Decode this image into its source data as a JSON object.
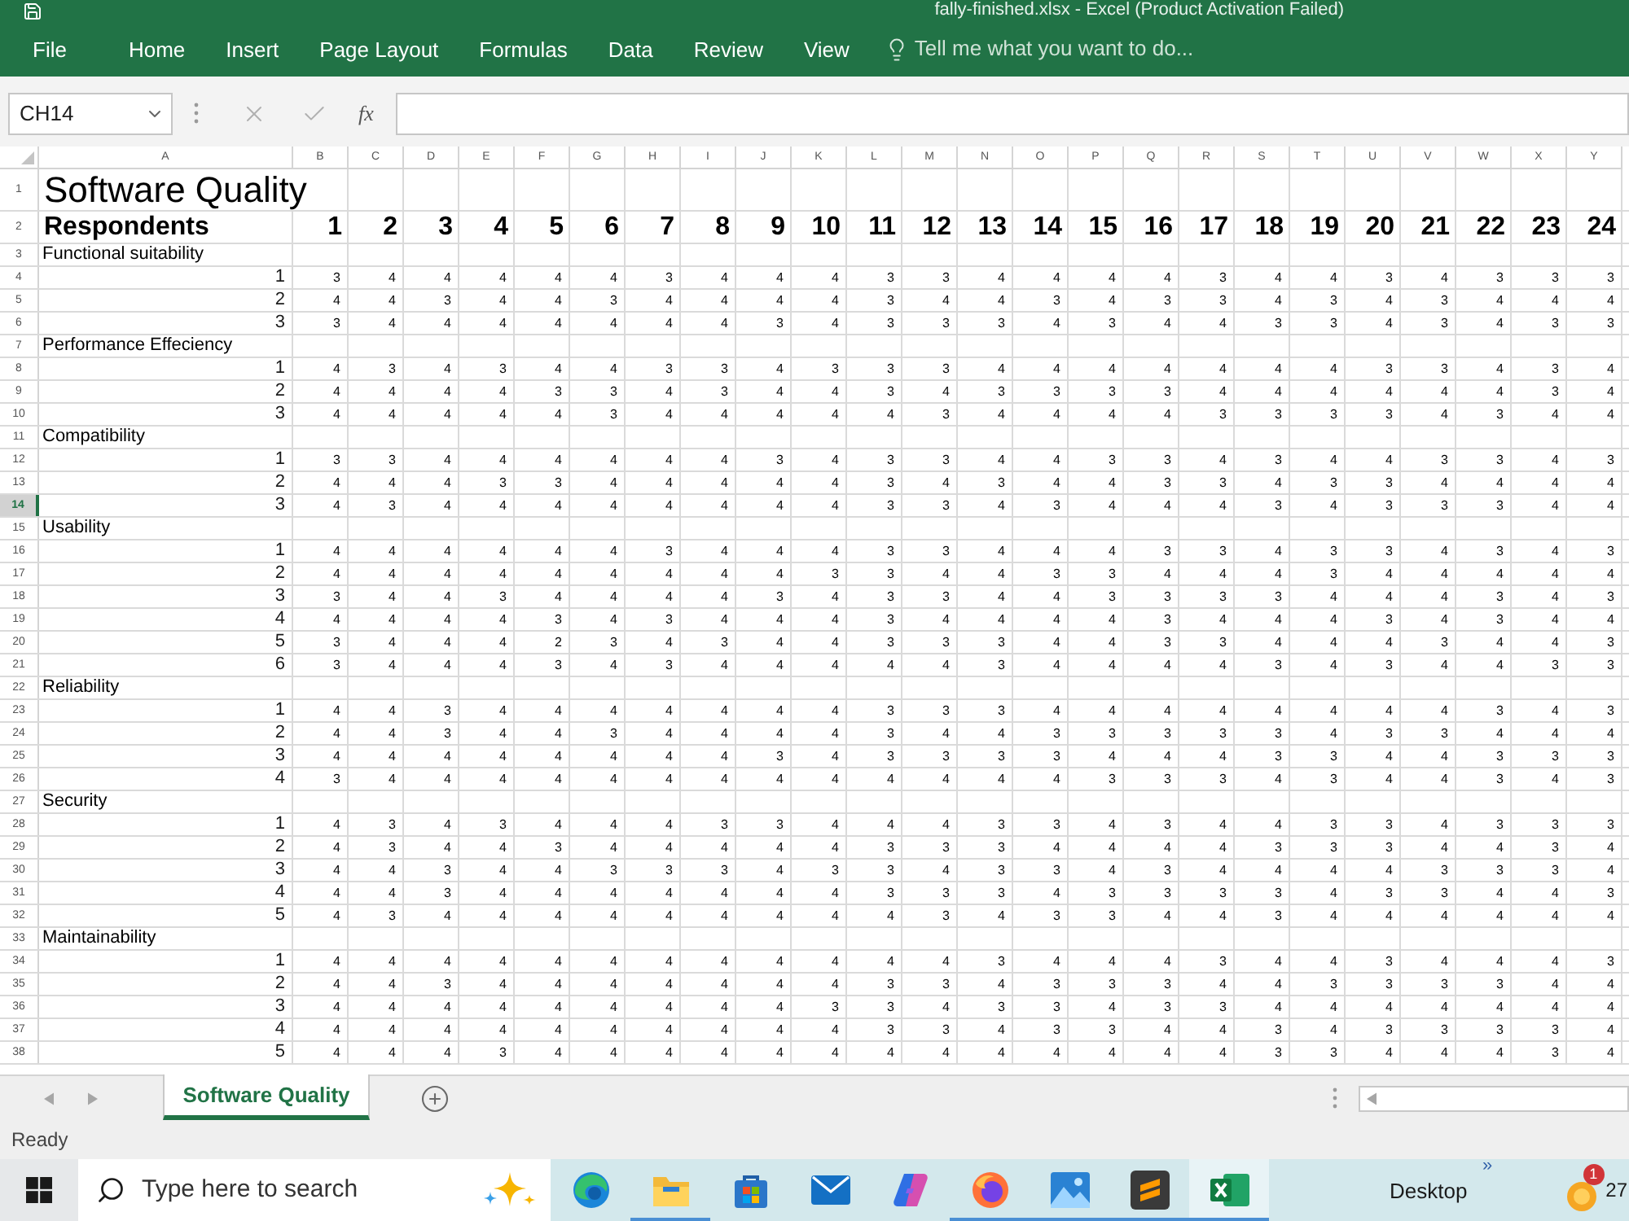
{
  "window": {
    "title": "fally-finished.xlsx - Excel (Product Activation Failed)"
  },
  "ribbon": {
    "file": "File",
    "tabs": [
      "Home",
      "Insert",
      "Page Layout",
      "Formulas",
      "Data",
      "Review",
      "View"
    ],
    "tell_me": {
      "placeholder": "Tell me what you want to do..."
    }
  },
  "formula_bar": {
    "name_box": "CH14",
    "function_button": "fx"
  },
  "sheet": {
    "columns": [
      "A",
      "B",
      "C",
      "D",
      "E",
      "F",
      "G",
      "H",
      "I",
      "J",
      "K",
      "L",
      "M",
      "N",
      "O",
      "P",
      "Q",
      "R",
      "S",
      "T",
      "U",
      "V",
      "W",
      "X",
      "Y"
    ],
    "rows": [
      {
        "number": "1",
        "kind": "title",
        "text": "Software Quality",
        "selected": false
      },
      {
        "number": "2",
        "kind": "header",
        "text": "Respondents",
        "values": [
          "1",
          "2",
          "3",
          "4",
          "5",
          "6",
          "7",
          "8",
          "9",
          "10",
          "11",
          "12",
          "13",
          "14",
          "15",
          "16",
          "17",
          "18",
          "19",
          "20",
          "21",
          "22",
          "23",
          "24"
        ],
        "selected": false
      },
      {
        "number": "3",
        "kind": "section",
        "text": "Functional suitability",
        "selected": false
      },
      {
        "number": "4",
        "kind": "data",
        "text": "1",
        "values": [
          "3",
          "4",
          "4",
          "4",
          "4",
          "4",
          "3",
          "4",
          "4",
          "4",
          "3",
          "3",
          "4",
          "4",
          "4",
          "4",
          "3",
          "4",
          "4",
          "3",
          "4",
          "3",
          "3",
          "3"
        ],
        "selected": false
      },
      {
        "number": "5",
        "kind": "data",
        "text": "2",
        "values": [
          "4",
          "4",
          "3",
          "4",
          "4",
          "3",
          "4",
          "4",
          "4",
          "4",
          "3",
          "4",
          "4",
          "3",
          "4",
          "3",
          "3",
          "4",
          "3",
          "4",
          "3",
          "4",
          "4",
          "4"
        ],
        "selected": false
      },
      {
        "number": "6",
        "kind": "data",
        "text": "3",
        "values": [
          "3",
          "4",
          "4",
          "4",
          "4",
          "4",
          "4",
          "4",
          "3",
          "4",
          "3",
          "3",
          "3",
          "4",
          "3",
          "4",
          "4",
          "3",
          "3",
          "4",
          "3",
          "4",
          "3",
          "3"
        ],
        "selected": false
      },
      {
        "number": "7",
        "kind": "section",
        "text": "Performance Effeciency",
        "selected": false
      },
      {
        "number": "8",
        "kind": "data",
        "text": "1",
        "values": [
          "4",
          "3",
          "4",
          "3",
          "4",
          "4",
          "3",
          "3",
          "4",
          "3",
          "3",
          "3",
          "4",
          "4",
          "4",
          "4",
          "4",
          "4",
          "4",
          "3",
          "3",
          "4",
          "3",
          "4"
        ],
        "selected": false
      },
      {
        "number": "9",
        "kind": "data",
        "text": "2",
        "values": [
          "4",
          "4",
          "4",
          "4",
          "3",
          "3",
          "4",
          "3",
          "4",
          "4",
          "3",
          "4",
          "3",
          "3",
          "3",
          "3",
          "4",
          "4",
          "4",
          "4",
          "4",
          "4",
          "3",
          "4"
        ],
        "selected": false
      },
      {
        "number": "10",
        "kind": "data",
        "text": "3",
        "values": [
          "4",
          "4",
          "4",
          "4",
          "4",
          "3",
          "4",
          "4",
          "4",
          "4",
          "4",
          "3",
          "4",
          "4",
          "4",
          "4",
          "3",
          "3",
          "3",
          "3",
          "4",
          "3",
          "4",
          "4"
        ],
        "selected": false
      },
      {
        "number": "11",
        "kind": "section",
        "text": "Compatibility",
        "selected": false
      },
      {
        "number": "12",
        "kind": "data",
        "text": "1",
        "values": [
          "3",
          "3",
          "4",
          "4",
          "4",
          "4",
          "4",
          "4",
          "3",
          "4",
          "3",
          "3",
          "4",
          "4",
          "3",
          "3",
          "4",
          "3",
          "4",
          "4",
          "3",
          "3",
          "4",
          "3"
        ],
        "selected": false
      },
      {
        "number": "13",
        "kind": "data",
        "text": "2",
        "values": [
          "4",
          "4",
          "4",
          "3",
          "3",
          "4",
          "4",
          "4",
          "4",
          "4",
          "3",
          "4",
          "3",
          "4",
          "4",
          "3",
          "3",
          "4",
          "3",
          "3",
          "4",
          "4",
          "4",
          "4"
        ],
        "selected": false
      },
      {
        "number": "14",
        "kind": "data",
        "text": "3",
        "values": [
          "4",
          "3",
          "4",
          "4",
          "4",
          "4",
          "4",
          "4",
          "4",
          "4",
          "3",
          "3",
          "4",
          "3",
          "4",
          "4",
          "4",
          "3",
          "4",
          "3",
          "3",
          "3",
          "4",
          "4"
        ],
        "selected": true
      },
      {
        "number": "15",
        "kind": "section",
        "text": "Usability",
        "selected": false
      },
      {
        "number": "16",
        "kind": "data",
        "text": "1",
        "values": [
          "4",
          "4",
          "4",
          "4",
          "4",
          "4",
          "3",
          "4",
          "4",
          "4",
          "3",
          "3",
          "4",
          "4",
          "4",
          "3",
          "3",
          "4",
          "3",
          "3",
          "4",
          "3",
          "4",
          "3"
        ],
        "selected": false
      },
      {
        "number": "17",
        "kind": "data",
        "text": "2",
        "values": [
          "4",
          "4",
          "4",
          "4",
          "4",
          "4",
          "4",
          "4",
          "4",
          "3",
          "3",
          "4",
          "4",
          "3",
          "3",
          "4",
          "4",
          "4",
          "3",
          "4",
          "4",
          "4",
          "4",
          "4"
        ],
        "selected": false
      },
      {
        "number": "18",
        "kind": "data",
        "text": "3",
        "values": [
          "3",
          "4",
          "4",
          "3",
          "4",
          "4",
          "4",
          "4",
          "3",
          "4",
          "3",
          "3",
          "4",
          "4",
          "3",
          "3",
          "3",
          "3",
          "4",
          "4",
          "4",
          "3",
          "4",
          "3"
        ],
        "selected": false
      },
      {
        "number": "19",
        "kind": "data",
        "text": "4",
        "values": [
          "4",
          "4",
          "4",
          "4",
          "3",
          "4",
          "3",
          "4",
          "4",
          "4",
          "3",
          "4",
          "4",
          "4",
          "4",
          "3",
          "4",
          "4",
          "4",
          "3",
          "4",
          "3",
          "4",
          "4"
        ],
        "selected": false
      },
      {
        "number": "20",
        "kind": "data",
        "text": "5",
        "values": [
          "3",
          "4",
          "4",
          "4",
          "2",
          "3",
          "4",
          "3",
          "4",
          "4",
          "3",
          "3",
          "3",
          "4",
          "4",
          "3",
          "3",
          "4",
          "4",
          "4",
          "3",
          "4",
          "4",
          "3"
        ],
        "selected": false
      },
      {
        "number": "21",
        "kind": "data",
        "text": "6",
        "values": [
          "3",
          "4",
          "4",
          "4",
          "3",
          "4",
          "3",
          "4",
          "4",
          "4",
          "4",
          "4",
          "3",
          "4",
          "4",
          "4",
          "4",
          "3",
          "4",
          "3",
          "4",
          "4",
          "3",
          "3"
        ],
        "selected": false
      },
      {
        "number": "22",
        "kind": "section",
        "text": "Reliability",
        "selected": false
      },
      {
        "number": "23",
        "kind": "data",
        "text": "1",
        "values": [
          "4",
          "4",
          "3",
          "4",
          "4",
          "4",
          "4",
          "4",
          "4",
          "4",
          "3",
          "3",
          "3",
          "4",
          "4",
          "4",
          "4",
          "4",
          "4",
          "4",
          "4",
          "3",
          "4",
          "3"
        ],
        "selected": false
      },
      {
        "number": "24",
        "kind": "data",
        "text": "2",
        "values": [
          "4",
          "4",
          "3",
          "4",
          "4",
          "3",
          "4",
          "4",
          "4",
          "4",
          "3",
          "4",
          "4",
          "3",
          "3",
          "3",
          "3",
          "3",
          "4",
          "3",
          "3",
          "4",
          "4",
          "4"
        ],
        "selected": false
      },
      {
        "number": "25",
        "kind": "data",
        "text": "3",
        "values": [
          "4",
          "4",
          "4",
          "4",
          "4",
          "4",
          "4",
          "4",
          "3",
          "4",
          "3",
          "3",
          "3",
          "3",
          "4",
          "4",
          "4",
          "3",
          "3",
          "4",
          "4",
          "3",
          "3",
          "3"
        ],
        "selected": false
      },
      {
        "number": "26",
        "kind": "data",
        "text": "4",
        "values": [
          "3",
          "4",
          "4",
          "4",
          "4",
          "4",
          "4",
          "4",
          "4",
          "4",
          "4",
          "4",
          "4",
          "4",
          "3",
          "3",
          "3",
          "4",
          "3",
          "4",
          "4",
          "3",
          "4",
          "3"
        ],
        "selected": false
      },
      {
        "number": "27",
        "kind": "section",
        "text": "Security",
        "selected": false
      },
      {
        "number": "28",
        "kind": "data",
        "text": "1",
        "values": [
          "4",
          "3",
          "4",
          "3",
          "4",
          "4",
          "4",
          "3",
          "3",
          "4",
          "4",
          "4",
          "3",
          "3",
          "4",
          "3",
          "4",
          "4",
          "3",
          "3",
          "4",
          "3",
          "3",
          "3"
        ],
        "selected": false
      },
      {
        "number": "29",
        "kind": "data",
        "text": "2",
        "values": [
          "4",
          "3",
          "4",
          "4",
          "3",
          "4",
          "4",
          "4",
          "4",
          "4",
          "3",
          "3",
          "3",
          "4",
          "4",
          "4",
          "4",
          "3",
          "3",
          "3",
          "4",
          "4",
          "3",
          "4"
        ],
        "selected": false
      },
      {
        "number": "30",
        "kind": "data",
        "text": "3",
        "values": [
          "4",
          "4",
          "3",
          "4",
          "4",
          "3",
          "3",
          "3",
          "4",
          "3",
          "3",
          "4",
          "3",
          "3",
          "4",
          "3",
          "4",
          "4",
          "4",
          "4",
          "3",
          "3",
          "3",
          "4"
        ],
        "selected": false
      },
      {
        "number": "31",
        "kind": "data",
        "text": "4",
        "values": [
          "4",
          "4",
          "3",
          "4",
          "4",
          "4",
          "4",
          "4",
          "4",
          "4",
          "3",
          "3",
          "3",
          "4",
          "3",
          "3",
          "3",
          "3",
          "4",
          "3",
          "3",
          "4",
          "4",
          "3"
        ],
        "selected": false
      },
      {
        "number": "32",
        "kind": "data",
        "text": "5",
        "values": [
          "4",
          "3",
          "4",
          "4",
          "4",
          "4",
          "4",
          "4",
          "4",
          "4",
          "4",
          "3",
          "4",
          "3",
          "3",
          "4",
          "4",
          "3",
          "4",
          "4",
          "4",
          "4",
          "4",
          "4"
        ],
        "selected": false
      },
      {
        "number": "33",
        "kind": "section",
        "text": "Maintainability",
        "selected": false
      },
      {
        "number": "34",
        "kind": "data",
        "text": "1",
        "values": [
          "4",
          "4",
          "4",
          "4",
          "4",
          "4",
          "4",
          "4",
          "4",
          "4",
          "4",
          "4",
          "3",
          "4",
          "4",
          "4",
          "3",
          "4",
          "4",
          "3",
          "4",
          "4",
          "4",
          "3"
        ],
        "selected": false
      },
      {
        "number": "35",
        "kind": "data",
        "text": "2",
        "values": [
          "4",
          "4",
          "3",
          "4",
          "4",
          "4",
          "4",
          "4",
          "4",
          "4",
          "3",
          "3",
          "4",
          "3",
          "3",
          "3",
          "4",
          "4",
          "3",
          "3",
          "3",
          "3",
          "4",
          "4"
        ],
        "selected": false
      },
      {
        "number": "36",
        "kind": "data",
        "text": "3",
        "values": [
          "4",
          "4",
          "4",
          "4",
          "4",
          "4",
          "4",
          "4",
          "4",
          "3",
          "3",
          "4",
          "3",
          "3",
          "4",
          "3",
          "3",
          "4",
          "4",
          "4",
          "4",
          "4",
          "4",
          "4"
        ],
        "selected": false
      },
      {
        "number": "37",
        "kind": "data",
        "text": "4",
        "values": [
          "4",
          "4",
          "4",
          "4",
          "4",
          "4",
          "4",
          "4",
          "4",
          "4",
          "3",
          "3",
          "4",
          "3",
          "3",
          "4",
          "4",
          "3",
          "4",
          "3",
          "3",
          "3",
          "3",
          "4"
        ],
        "selected": false
      },
      {
        "number": "38",
        "kind": "data",
        "text": "5",
        "values": [
          "4",
          "4",
          "4",
          "3",
          "4",
          "4",
          "4",
          "4",
          "4",
          "4",
          "4",
          "4",
          "4",
          "4",
          "4",
          "4",
          "4",
          "3",
          "3",
          "4",
          "4",
          "4",
          "3",
          "4"
        ],
        "selected": false
      }
    ]
  },
  "sheet_tabs": [
    {
      "label": "Software Quality",
      "selected": true
    }
  ],
  "status_bar": {
    "text": "Ready"
  },
  "taskbar": {
    "search": {
      "placeholder": "Type here to search"
    },
    "apps": [
      {
        "kind": "edge",
        "selected": false,
        "running": false
      },
      {
        "kind": "explorer",
        "selected": false,
        "running": true
      },
      {
        "kind": "store",
        "selected": false,
        "running": false
      },
      {
        "kind": "mail",
        "selected": false,
        "running": false
      },
      {
        "kind": "copilot",
        "selected": false,
        "running": false
      },
      {
        "kind": "firefox",
        "selected": false,
        "running": true
      },
      {
        "kind": "photos",
        "selected": false,
        "running": true
      },
      {
        "kind": "sublime",
        "selected": false,
        "running": true
      },
      {
        "kind": "excel",
        "selected": true,
        "running": true
      }
    ],
    "desktop": {
      "label": "Desktop",
      "chevron": "»"
    },
    "notification_count": "1",
    "clock": "27"
  }
}
